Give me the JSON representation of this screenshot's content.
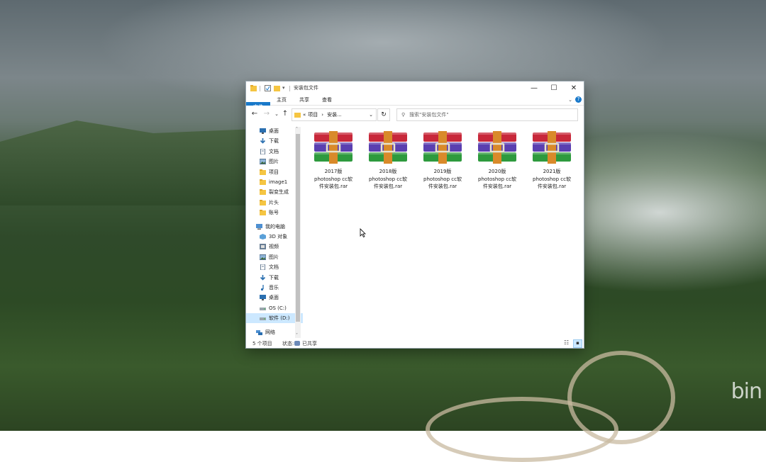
{
  "window": {
    "title": "安装包文件",
    "controls": {
      "minimize": "—",
      "maximize": "☐",
      "close": "✕"
    }
  },
  "ribbon": {
    "tabs": [
      "文件",
      "主页",
      "共享",
      "查看"
    ],
    "help": "?",
    "collapse": "⌄"
  },
  "address": {
    "breadcrumb": [
      "«",
      "项目",
      "›",
      "安装..."
    ],
    "search_placeholder": "搜索\"安装包文件\""
  },
  "sidebar": {
    "quick_access": [
      {
        "label": "桌面",
        "icon": "desktop-icon",
        "pinned": true
      },
      {
        "label": "下载",
        "icon": "download-icon",
        "pinned": true
      },
      {
        "label": "文档",
        "icon": "document-icon",
        "pinned": true
      },
      {
        "label": "图片",
        "icon": "pictures-icon",
        "pinned": true
      },
      {
        "label": "项目",
        "icon": "folder-icon",
        "pinned": true
      },
      {
        "label": "image1",
        "icon": "folder-icon",
        "pinned": false
      },
      {
        "label": "裂变生成",
        "icon": "folder-icon",
        "pinned": false
      },
      {
        "label": "片头",
        "icon": "folder-icon",
        "pinned": false
      },
      {
        "label": "账号",
        "icon": "folder-icon",
        "pinned": false
      }
    ],
    "this_pc": [
      {
        "label": "我的电脑",
        "icon": "computer-icon"
      },
      {
        "label": "3D 对象",
        "icon": "3d-objects-icon"
      },
      {
        "label": "视频",
        "icon": "videos-icon"
      },
      {
        "label": "图片",
        "icon": "pictures-icon"
      },
      {
        "label": "文档",
        "icon": "document-icon"
      },
      {
        "label": "下载",
        "icon": "download-icon"
      },
      {
        "label": "音乐",
        "icon": "music-icon"
      },
      {
        "label": "桌面",
        "icon": "desktop-icon"
      },
      {
        "label": "OS (C:)",
        "icon": "drive-icon"
      },
      {
        "label": "软件 (D:)",
        "icon": "drive-icon",
        "selected": true
      }
    ],
    "network": {
      "label": "网络",
      "icon": "network-icon"
    }
  },
  "files": [
    {
      "line1": "2017版",
      "line2": "photoshop cc软",
      "line3": "件安装包.rar",
      "icon": "winrar-archive-icon"
    },
    {
      "line1": "2018版",
      "line2": "photoshop cc软",
      "line3": "件安装包.rar",
      "icon": "winrar-archive-icon"
    },
    {
      "line1": "2019版",
      "line2": "photoshop cc软",
      "line3": "件安装包.rar",
      "icon": "winrar-archive-icon"
    },
    {
      "line1": "2020版",
      "line2": "photoshop cc软",
      "line3": "件安装包.rar",
      "icon": "winrar-archive-icon"
    },
    {
      "line1": "2021版",
      "line2": "photoshop cc软",
      "line3": "件安装包.rar",
      "icon": "winrar-archive-icon"
    }
  ],
  "status": {
    "count": "5 个项目",
    "state_label": "状态:",
    "state_value": "已共享"
  },
  "desktop": {
    "watermark": "bin"
  },
  "colors": {
    "accent": "#1979ca",
    "selection": "#cce8ff",
    "folder": "#f5c542"
  }
}
